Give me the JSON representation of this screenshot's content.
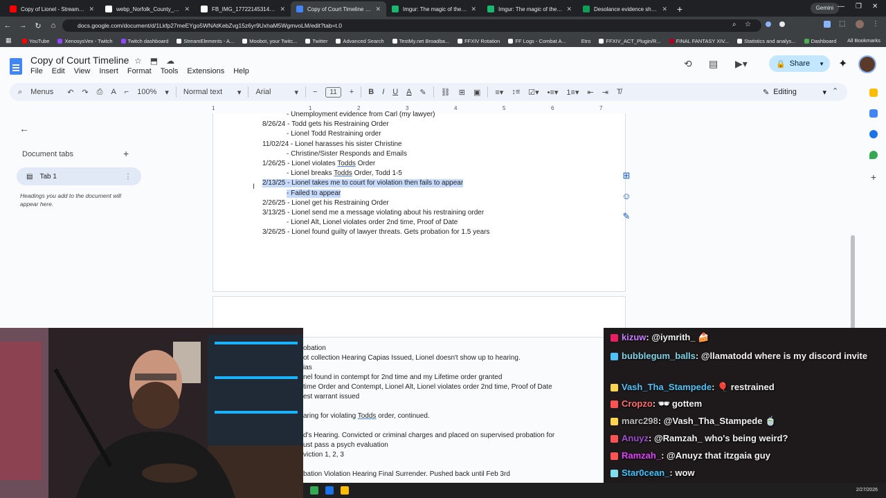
{
  "browser": {
    "tabs": [
      {
        "title": "Copy of Lionel - Stream/Youtub",
        "color": "#ff0000"
      },
      {
        "title": "webp_Norfolk_County_Correcti",
        "color": "#ffffff"
      },
      {
        "title": "FB_IMG_1772214531415.jpg (5",
        "color": "#ffffff"
      },
      {
        "title": "Copy of Court Timeline - Goog",
        "color": "#4285f4",
        "active": true
      },
      {
        "title": "Imgur: The magic of the Intern",
        "color": "#1bb76e"
      },
      {
        "title": "Imgur: The magic of the Intern",
        "color": "#1bb76e"
      },
      {
        "title": "Desolance evidence sheet - Go",
        "color": "#0f9d58"
      }
    ],
    "gemini_label": "Gemini",
    "url": "docs.google.com/document/d/1Lkfp27meEYgo5WNAtKebZvg15z6yr9UxhaM5WgmvoLM/edit?tab=t.0",
    "bookmarks": [
      {
        "label": "YouTube",
        "color": "#ff0000"
      },
      {
        "label": "XenosysVex - Twitch",
        "color": "#9146ff"
      },
      {
        "label": "Twitch dashboard",
        "color": "#9146ff"
      },
      {
        "label": "StreamElements - A...",
        "color": "#ffffff"
      },
      {
        "label": "Moobot, your Twitc...",
        "color": "#ffffff"
      },
      {
        "label": "Twitter",
        "color": "#ffffff"
      },
      {
        "label": "Advanced Search",
        "color": "#ffffff"
      },
      {
        "label": "TestMy.net Broadba...",
        "color": "#ffffff"
      },
      {
        "label": "FFXIV Rotation",
        "color": "#ffffff"
      },
      {
        "label": "FF Logs - Combat A...",
        "color": "#ffffff"
      },
      {
        "label": "Etro",
        "color": "#3c4043"
      },
      {
        "label": "FFXIV_ACT_Plugin/R...",
        "color": "#ffffff"
      },
      {
        "label": "FINAL FANTASY XIV...",
        "color": "#b00020"
      },
      {
        "label": "Statistics and analys...",
        "color": "#ffffff"
      },
      {
        "label": "Dashboard",
        "color": "#4caf50"
      }
    ],
    "all_bookmarks": "All Bookmarks"
  },
  "docs": {
    "title": "Copy of Court Timeline",
    "menu": [
      "File",
      "Edit",
      "View",
      "Insert",
      "Format",
      "Tools",
      "Extensions",
      "Help"
    ],
    "share_label": "Share",
    "toolbar": {
      "menus": "Menus",
      "zoom": "100%",
      "style": "Normal text",
      "font": "Arial",
      "size": "11",
      "mode": "Editing"
    },
    "ruler_ticks": [
      "1",
      "1",
      "2",
      "3",
      "4",
      "5",
      "6",
      "7"
    ],
    "tabs_panel": {
      "title": "Document tabs",
      "tab_name": "Tab 1",
      "hint": "Headings you add to the document will appear here."
    },
    "body_lines": [
      "- Unemployment evidence from Carl (my lawyer)",
      "8/26/24 - Todd gets his Restraining Order",
      "- Lionel Todd Restraining order",
      "11/02/24 - Lionel harasses his sister Christine",
      "- Christine/Sister Responds and Emails",
      "1/26/25 - Lionel violates Todds Order",
      "- Lionel breaks Todds Order, Todd 1-5",
      "2/13/25 - Lionel takes me to court for violation then fails to appear",
      "- Failed to appear",
      "2/26/25 - Lionel get his Restraining Order",
      "3/13/25 - Lionel send me a message violating about his restraining order",
      "- Lionel Alt, Lionel violates order 2nd time, Proof of Date",
      "3/26/25 - Lionel found guilty of lawyer threats. Gets probation for 1.5 years"
    ],
    "page2_lines": [
      "obation",
      "ot collection Hearing Capias Issued, Lionel doesn't show up to hearing.",
      "ias",
      "nel found in contempt for 2nd time and my Lifetime order granted",
      "time Order and Contempt, Lionel Alt, Lionel violates order 2nd time, Proof of Date",
      "est warrant issued",
      "aring for violating Todds order, continued.",
      "d's Hearing. Convicted or criminal charges and placed on supervised probation for",
      "ust pass a psych evaluation",
      "viction 1, 2, 3",
      "bation Violation Hearing Final Surrender. Pushed back until Feb 3rd"
    ]
  },
  "chat": [
    {
      "user": "kizuw",
      "msg": ": @iymrith_ 🍰",
      "color": "#c77dff",
      "badge": "#e91e63"
    },
    {
      "user": "bubblegum_balls",
      "msg": ": @llamatodd where is my discord invite",
      "color": "#7fd3e6",
      "badge": "#4fc3f7"
    },
    {
      "user": "Vash_Tha_Stampede",
      "msg": ": 🎈 restrained",
      "color": "#4fc3f7",
      "badge": "#ffd54f"
    },
    {
      "user": "Cropzo",
      "msg": ": 🕶 gottem",
      "color": "#ff6b6b",
      "badge": "#ff5252"
    },
    {
      "user": "marc298",
      "msg": ": @Vash_Tha_Stampede 🍵",
      "color": "#bdbdbd",
      "badge": "#ffd54f"
    },
    {
      "user": "Anuyz",
      "msg": ": @Ramzah_ who's being weird?",
      "color": "#9c4dcc",
      "badge": "#ff5252"
    },
    {
      "user": "Ramzah_",
      "msg": ": @Anuyz that itzgaia guy",
      "color": "#e040fb",
      "badge": "#ff5252"
    },
    {
      "user": "Star0cean_",
      "msg": ": wow",
      "color": "#40c4ff",
      "badge": "#80deea"
    }
  ],
  "taskbar": {
    "date": "2/27/2026"
  }
}
